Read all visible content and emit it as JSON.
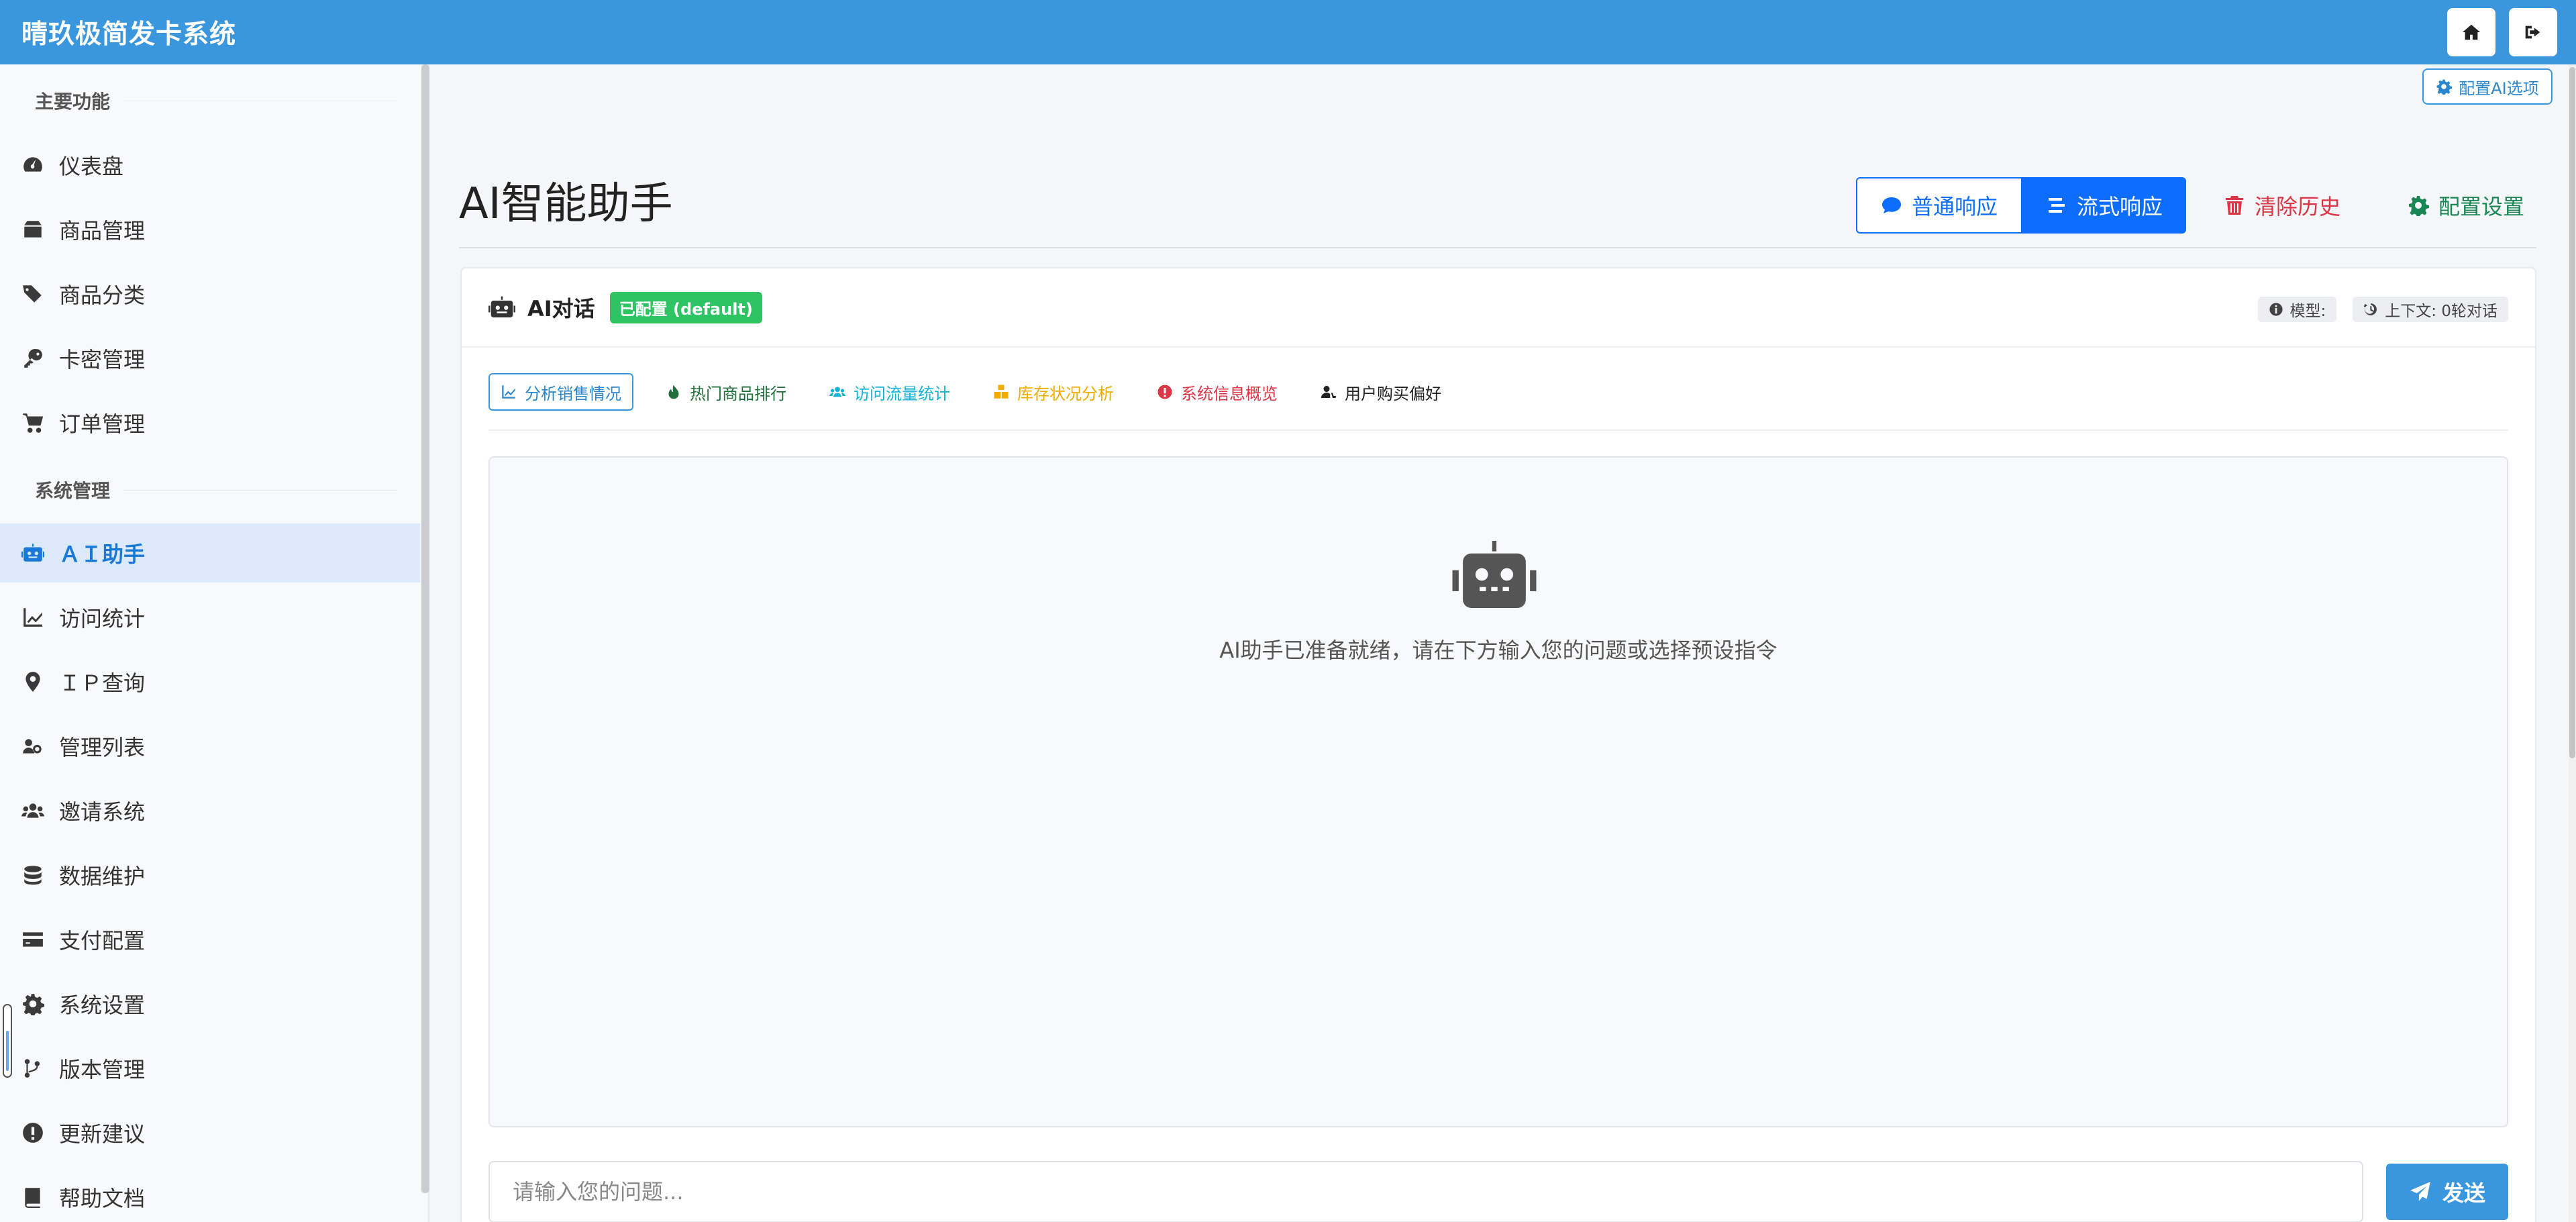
{
  "app": {
    "brand": "晴玖极简发卡系统"
  },
  "sidebar": {
    "sections": [
      {
        "title": "主要功能"
      },
      {
        "title": "系统管理"
      }
    ],
    "items": [
      {
        "label": "仪表盘",
        "icon": "gauge-icon"
      },
      {
        "label": "商品管理",
        "icon": "box-icon"
      },
      {
        "label": "商品分类",
        "icon": "tags-icon"
      },
      {
        "label": "卡密管理",
        "icon": "key-icon"
      },
      {
        "label": "订单管理",
        "icon": "cart-icon"
      },
      {
        "label": "ＡＩ助手",
        "icon": "robot-icon",
        "active": true
      },
      {
        "label": "访问统计",
        "icon": "chart-line-icon"
      },
      {
        "label": "ＩＰ查询",
        "icon": "map-pin-icon"
      },
      {
        "label": "管理列表",
        "icon": "users-cog-icon"
      },
      {
        "label": "邀请系统",
        "icon": "users-icon"
      },
      {
        "label": "数据维护",
        "icon": "database-icon"
      },
      {
        "label": "支付配置",
        "icon": "credit-card-icon"
      },
      {
        "label": "系统设置",
        "icon": "gear-icon"
      },
      {
        "label": "版本管理",
        "icon": "code-branch-icon"
      },
      {
        "label": "更新建议",
        "icon": "exclamation-circle-icon"
      },
      {
        "label": "帮助文档",
        "icon": "book-icon"
      }
    ]
  },
  "main": {
    "config_ai_label": "配置AI选项",
    "title": "AI智能助手",
    "actions": {
      "normal": "普通响应",
      "stream": "流式响应",
      "clear": "清除历史",
      "config": "配置设置"
    },
    "card": {
      "title": "AI对话",
      "badge": "已配置 (default)",
      "model_label": "模型:",
      "context_label": "上下文: 0轮对话"
    },
    "presets": [
      {
        "label": "分析销售情况",
        "icon": "chart-line-icon"
      },
      {
        "label": "热门商品排行",
        "icon": "fire-icon"
      },
      {
        "label": "访问流量统计",
        "icon": "users-icon"
      },
      {
        "label": "库存状况分析",
        "icon": "boxes-icon"
      },
      {
        "label": "系统信息概览",
        "icon": "exclamation-circle-icon"
      },
      {
        "label": "用户购买偏好",
        "icon": "user-cart-icon"
      }
    ],
    "chat": {
      "empty_text": "AI助手已准备就绪，请在下方输入您的问题或选择预设指令"
    },
    "input": {
      "placeholder": "请输入您的问题...",
      "value": ""
    },
    "send_label": "发送"
  },
  "colors": {
    "topbar": "#3b97dd",
    "primary": "#0d6efd",
    "danger": "#dc3545",
    "success": "#198754",
    "badge": "#2ec463",
    "sidebar_active_bg": "#dbe9f8"
  }
}
